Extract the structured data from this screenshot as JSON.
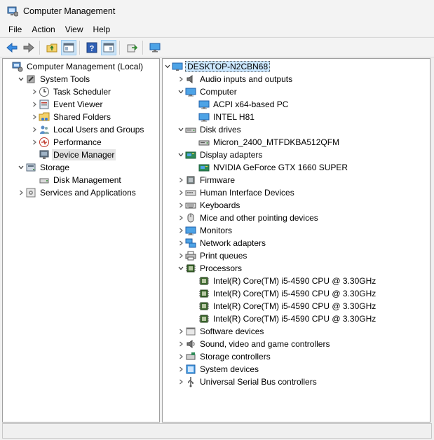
{
  "window": {
    "title": "Computer Management"
  },
  "menu": [
    "File",
    "Action",
    "View",
    "Help"
  ],
  "toolbar": {
    "buttons": [
      "back-icon",
      "forward-icon",
      "up-folder-icon",
      "show-hide-tree-icon",
      "help-icon",
      "properties-icon",
      "export-icon",
      "monitor-icon"
    ]
  },
  "left_tree": [
    {
      "label": "Computer Management (Local)",
      "icon": "computer-management-icon",
      "chevron": "",
      "indent": 0
    },
    {
      "label": "System Tools",
      "icon": "system-tools-icon",
      "chevron": "down",
      "indent": 1
    },
    {
      "label": "Task Scheduler",
      "icon": "clock-icon",
      "chevron": "right",
      "indent": 2
    },
    {
      "label": "Event Viewer",
      "icon": "event-viewer-icon",
      "chevron": "right",
      "indent": 2
    },
    {
      "label": "Shared Folders",
      "icon": "shared-folders-icon",
      "chevron": "right",
      "indent": 2
    },
    {
      "label": "Local Users and Groups",
      "icon": "users-icon",
      "chevron": "right",
      "indent": 2
    },
    {
      "label": "Performance",
      "icon": "performance-icon",
      "chevron": "right",
      "indent": 2
    },
    {
      "label": "Device Manager",
      "icon": "device-manager-icon",
      "chevron": "",
      "indent": 2,
      "selected": true
    },
    {
      "label": "Storage",
      "icon": "storage-icon",
      "chevron": "down",
      "indent": 1
    },
    {
      "label": "Disk Management",
      "icon": "disk-management-icon",
      "chevron": "",
      "indent": 2
    },
    {
      "label": "Services and Applications",
      "icon": "services-icon",
      "chevron": "right",
      "indent": 1
    }
  ],
  "right_tree": [
    {
      "label": "DESKTOP-N2CBN68",
      "icon": "computer-icon",
      "chevron": "down",
      "indent": 0,
      "outlined": true
    },
    {
      "label": "Audio inputs and outputs",
      "icon": "speaker-icon",
      "chevron": "right",
      "indent": 1
    },
    {
      "label": "Computer",
      "icon": "monitor-icon",
      "chevron": "down",
      "indent": 1
    },
    {
      "label": "ACPI x64-based PC",
      "icon": "monitor-icon",
      "chevron": "",
      "indent": 2
    },
    {
      "label": "INTEL H81",
      "icon": "monitor-icon",
      "chevron": "",
      "indent": 2
    },
    {
      "label": "Disk drives",
      "icon": "disk-drive-icon",
      "chevron": "down",
      "indent": 1
    },
    {
      "label": "Micron_2400_MTFDKBA512QFM",
      "icon": "disk-drive-icon",
      "chevron": "",
      "indent": 2
    },
    {
      "label": "Display adapters",
      "icon": "display-adapter-icon",
      "chevron": "down",
      "indent": 1
    },
    {
      "label": "NVIDIA GeForce GTX 1660 SUPER",
      "icon": "display-adapter-icon",
      "chevron": "",
      "indent": 2
    },
    {
      "label": "Firmware",
      "icon": "firmware-icon",
      "chevron": "right",
      "indent": 1
    },
    {
      "label": "Human Interface Devices",
      "icon": "hid-icon",
      "chevron": "right",
      "indent": 1
    },
    {
      "label": "Keyboards",
      "icon": "keyboard-icon",
      "chevron": "right",
      "indent": 1
    },
    {
      "label": "Mice and other pointing devices",
      "icon": "mouse-icon",
      "chevron": "right",
      "indent": 1
    },
    {
      "label": "Monitors",
      "icon": "monitor-icon",
      "chevron": "right",
      "indent": 1
    },
    {
      "label": "Network adapters",
      "icon": "network-icon",
      "chevron": "right",
      "indent": 1
    },
    {
      "label": "Print queues",
      "icon": "printer-icon",
      "chevron": "right",
      "indent": 1
    },
    {
      "label": "Processors",
      "icon": "processor-icon",
      "chevron": "down",
      "indent": 1
    },
    {
      "label": "Intel(R) Core(TM) i5-4590 CPU @ 3.30GHz",
      "icon": "processor-icon",
      "chevron": "",
      "indent": 2
    },
    {
      "label": "Intel(R) Core(TM) i5-4590 CPU @ 3.30GHz",
      "icon": "processor-icon",
      "chevron": "",
      "indent": 2
    },
    {
      "label": "Intel(R) Core(TM) i5-4590 CPU @ 3.30GHz",
      "icon": "processor-icon",
      "chevron": "",
      "indent": 2
    },
    {
      "label": "Intel(R) Core(TM) i5-4590 CPU @ 3.30GHz",
      "icon": "processor-icon",
      "chevron": "",
      "indent": 2
    },
    {
      "label": "Software devices",
      "icon": "software-device-icon",
      "chevron": "right",
      "indent": 1
    },
    {
      "label": "Sound, video and game controllers",
      "icon": "sound-icon",
      "chevron": "right",
      "indent": 1
    },
    {
      "label": "Storage controllers",
      "icon": "storage-controller-icon",
      "chevron": "right",
      "indent": 1
    },
    {
      "label": "System devices",
      "icon": "system-device-icon",
      "chevron": "right",
      "indent": 1
    },
    {
      "label": "Universal Serial Bus controllers",
      "icon": "usb-icon",
      "chevron": "right",
      "indent": 1
    }
  ]
}
